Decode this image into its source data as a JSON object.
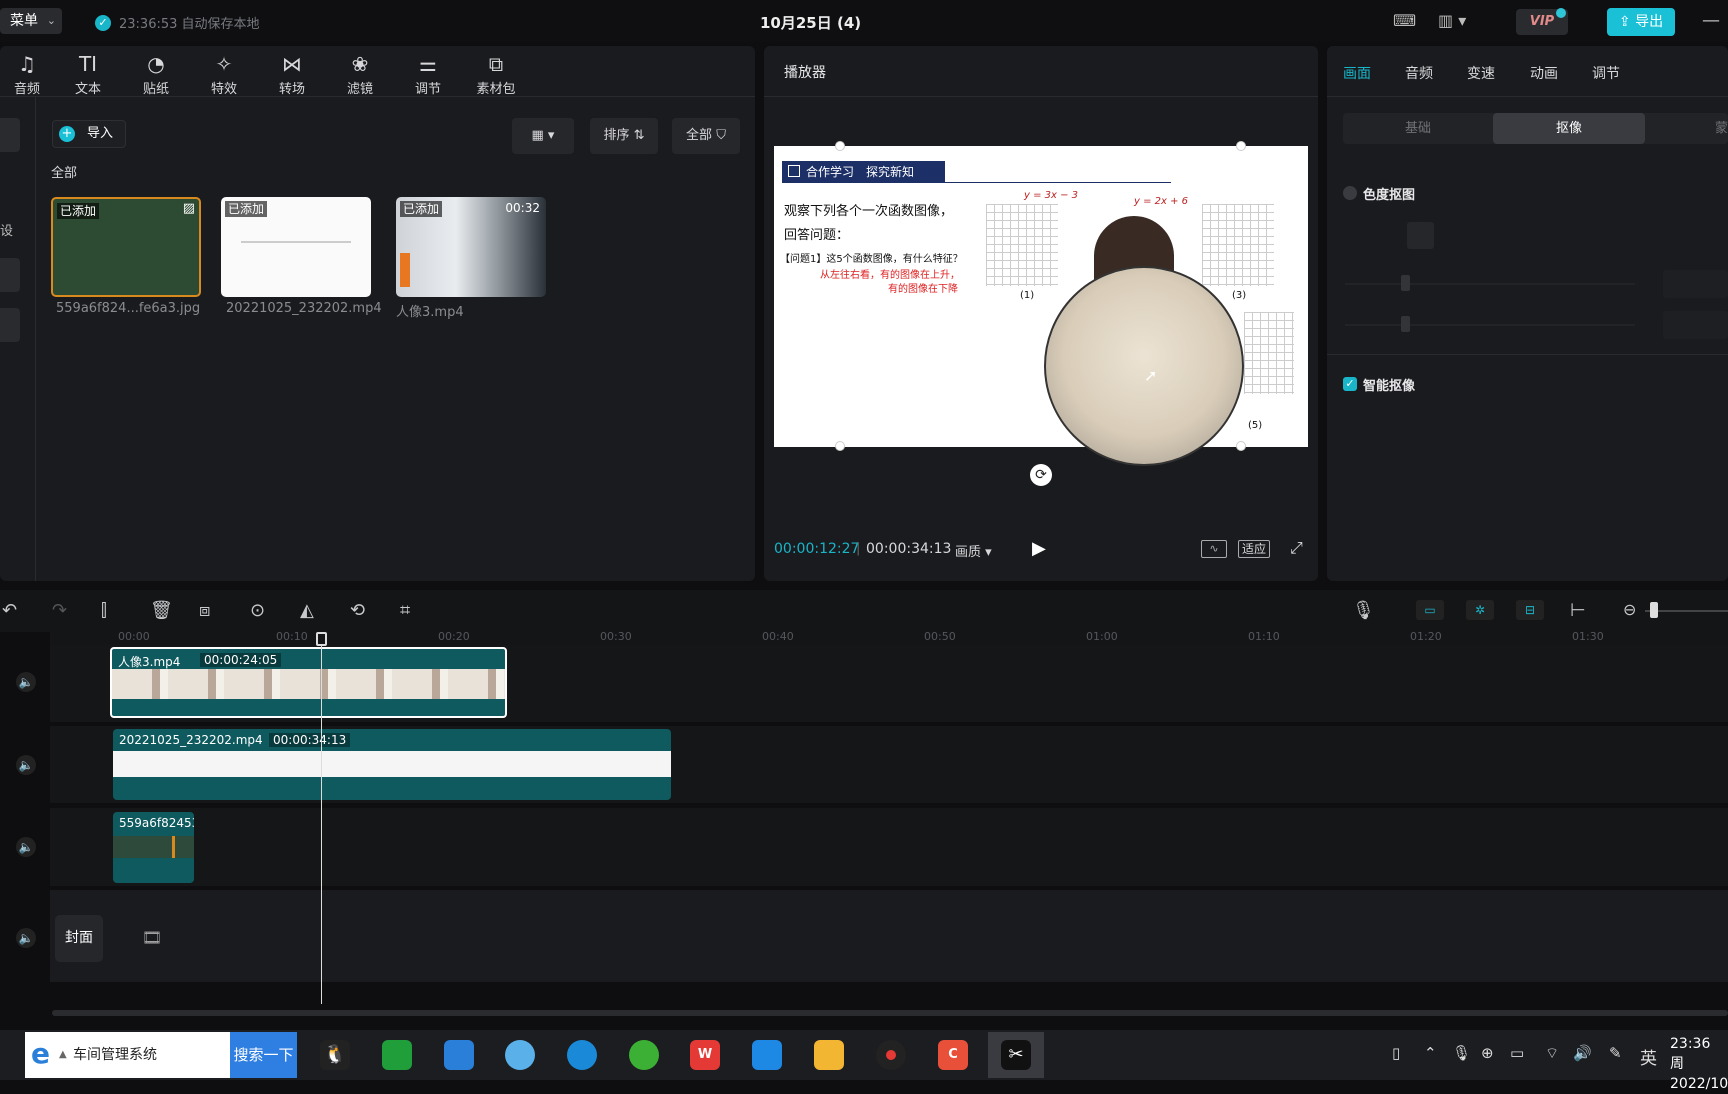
{
  "topbar": {
    "menu": "菜单",
    "autosave": "23:36:53 自动保存本地",
    "title": "10月25日 (4)",
    "vip": "VIP",
    "export": "导出"
  },
  "tools": [
    "音频",
    "文本",
    "贴纸",
    "特效",
    "转场",
    "滤镜",
    "调节",
    "素材包"
  ],
  "media": {
    "import": "导入",
    "sort": "排序",
    "filter": "全部",
    "section": "全部",
    "items": [
      {
        "badge": "已添加",
        "name": "559a6f824...fe6a3.jpg",
        "duration": ""
      },
      {
        "badge": "已添加",
        "name": "20221025_232202.mp4",
        "duration": ""
      },
      {
        "badge": "已添加",
        "name": "人像3.mp4",
        "duration": "00:32"
      }
    ]
  },
  "player": {
    "title": "播放器",
    "current": "00:00:12:27",
    "total": "00:00:34:13",
    "quality": "画质",
    "fit": "适应",
    "slide": {
      "heading": "合作学习　探究新知",
      "line1": "观察下列各个一次函数图像，",
      "line2": "回答问题：",
      "q1": "【问题1】这5个函数图像，有什么特征？",
      "red1": "从左往右看，有的图像在上升，",
      "red2": "有的图像在下降",
      "f1": "y = 3x − 3",
      "f2": "y = 2x + 6",
      "n1": "(1)",
      "n3": "(3)",
      "n5": "(5)"
    }
  },
  "right": {
    "tabs": [
      "画面",
      "音频",
      "变速",
      "动画",
      "调节"
    ],
    "segments": [
      "基础",
      "抠像",
      "蒙"
    ],
    "chroma": "色度抠图",
    "smart": "智能抠像"
  },
  "timeline": {
    "ticks": [
      "00:00",
      "00:10",
      "00:20",
      "00:30",
      "00:40",
      "00:50",
      "01:00",
      "01:10",
      "01:20",
      "01:30"
    ],
    "clips": [
      {
        "name": "人像3.mp4",
        "time": "00:00:24:05"
      },
      {
        "name": "20221025_232202.mp4",
        "time": "00:00:34:13"
      },
      {
        "name": "559a6f82453",
        "time": ""
      }
    ],
    "cover": "封面"
  },
  "taskbar": {
    "search_text": "车间管理系统",
    "search_btn": "搜索一下",
    "ime": "英",
    "time": "23:36 周",
    "date": "2022/10"
  }
}
